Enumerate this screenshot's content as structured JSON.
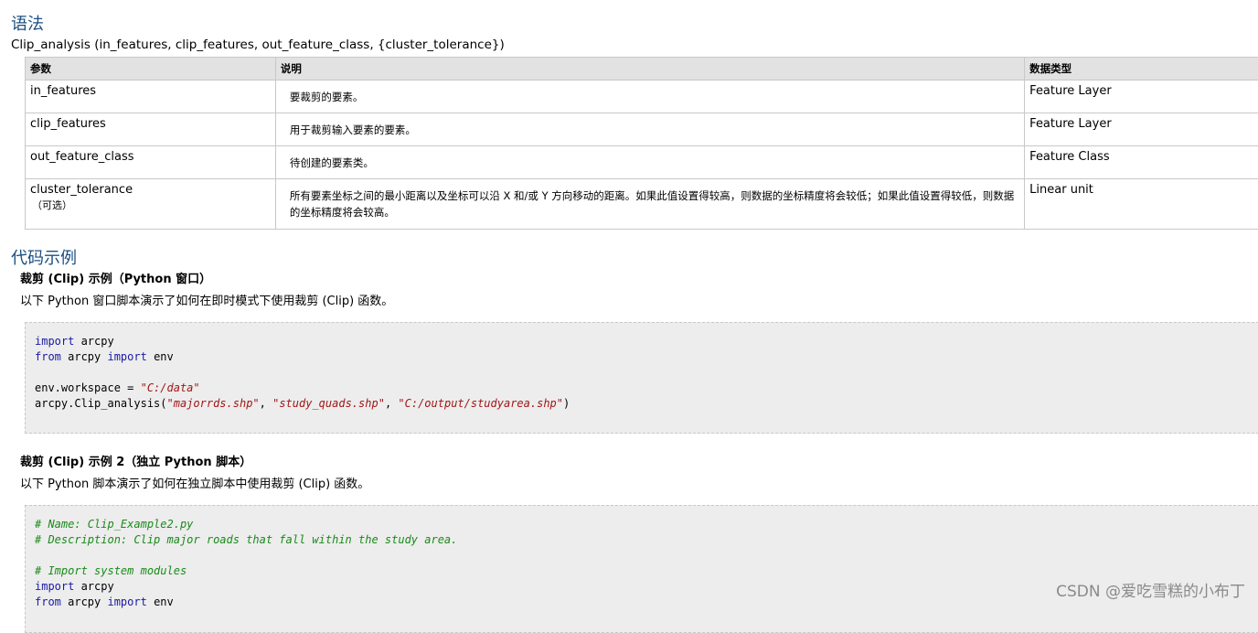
{
  "syntax": {
    "heading": "语法",
    "signature": "Clip_analysis (in_features, clip_features, out_feature_class, {cluster_tolerance})"
  },
  "params_table": {
    "headers": [
      "参数",
      "说明",
      "数据类型"
    ],
    "rows": [
      {
        "name": "in_features",
        "optional": "",
        "desc": "要裁剪的要素。",
        "type": "Feature Layer"
      },
      {
        "name": "clip_features",
        "optional": "",
        "desc": "用于裁剪输入要素的要素。",
        "type": "Feature Layer"
      },
      {
        "name": "out_feature_class",
        "optional": "",
        "desc": "待创建的要素类。",
        "type": "Feature Class"
      },
      {
        "name": "cluster_tolerance",
        "optional": "（可选）",
        "desc": "所有要素坐标之间的最小距离以及坐标可以沿 X 和/或 Y 方向移动的距离。如果此值设置得较高，则数据的坐标精度将会较低；如果此值设置得较低，则数据的坐标精度将会较高。",
        "type": "Linear unit"
      }
    ]
  },
  "code_samples": {
    "heading": "代码示例",
    "example1": {
      "title": "裁剪 (Clip) 示例（Python 窗口）",
      "description": "以下 Python 窗口脚本演示了如何在即时模式下使用裁剪 (Clip) 函数。",
      "lines": [
        [
          {
            "t": "import",
            "c": "kw"
          },
          {
            "t": " arcpy",
            "c": ""
          }
        ],
        [
          {
            "t": "from",
            "c": "kw"
          },
          {
            "t": " arcpy ",
            "c": ""
          },
          {
            "t": "import",
            "c": "kw"
          },
          {
            "t": " env",
            "c": ""
          }
        ],
        [],
        [
          {
            "t": "env.workspace = ",
            "c": ""
          },
          {
            "t": "\"C:/data\"",
            "c": "str"
          }
        ],
        [
          {
            "t": "arcpy.Clip_analysis(",
            "c": ""
          },
          {
            "t": "\"majorrds.shp\"",
            "c": "str"
          },
          {
            "t": ", ",
            "c": ""
          },
          {
            "t": "\"study_quads.shp\"",
            "c": "str"
          },
          {
            "t": ", ",
            "c": ""
          },
          {
            "t": "\"C:/output/studyarea.shp\"",
            "c": "str"
          },
          {
            "t": ")",
            "c": ""
          }
        ]
      ]
    },
    "example2": {
      "title": "裁剪 (Clip) 示例 2（独立 Python 脚本）",
      "description": "以下 Python 脚本演示了如何在独立脚本中使用裁剪 (Clip) 函数。",
      "lines": [
        [
          {
            "t": "# Name: Clip_Example2.py",
            "c": "cm"
          }
        ],
        [
          {
            "t": "# Description: Clip major roads that fall within the study area.",
            "c": "cm"
          }
        ],
        [],
        [
          {
            "t": "# Import system modules",
            "c": "cm"
          }
        ],
        [
          {
            "t": "import",
            "c": "kw"
          },
          {
            "t": " arcpy",
            "c": ""
          }
        ],
        [
          {
            "t": "from",
            "c": "kw"
          },
          {
            "t": " arcpy ",
            "c": ""
          },
          {
            "t": "import",
            "c": "kw"
          },
          {
            "t": " env",
            "c": ""
          }
        ]
      ]
    }
  },
  "watermark": "CSDN @爱吃雪糕的小布丁",
  "colors": {
    "heading": "#1c4f80",
    "keyword": "#1a1aa6",
    "string": "#a31515",
    "comment": "#1a8a1a"
  }
}
